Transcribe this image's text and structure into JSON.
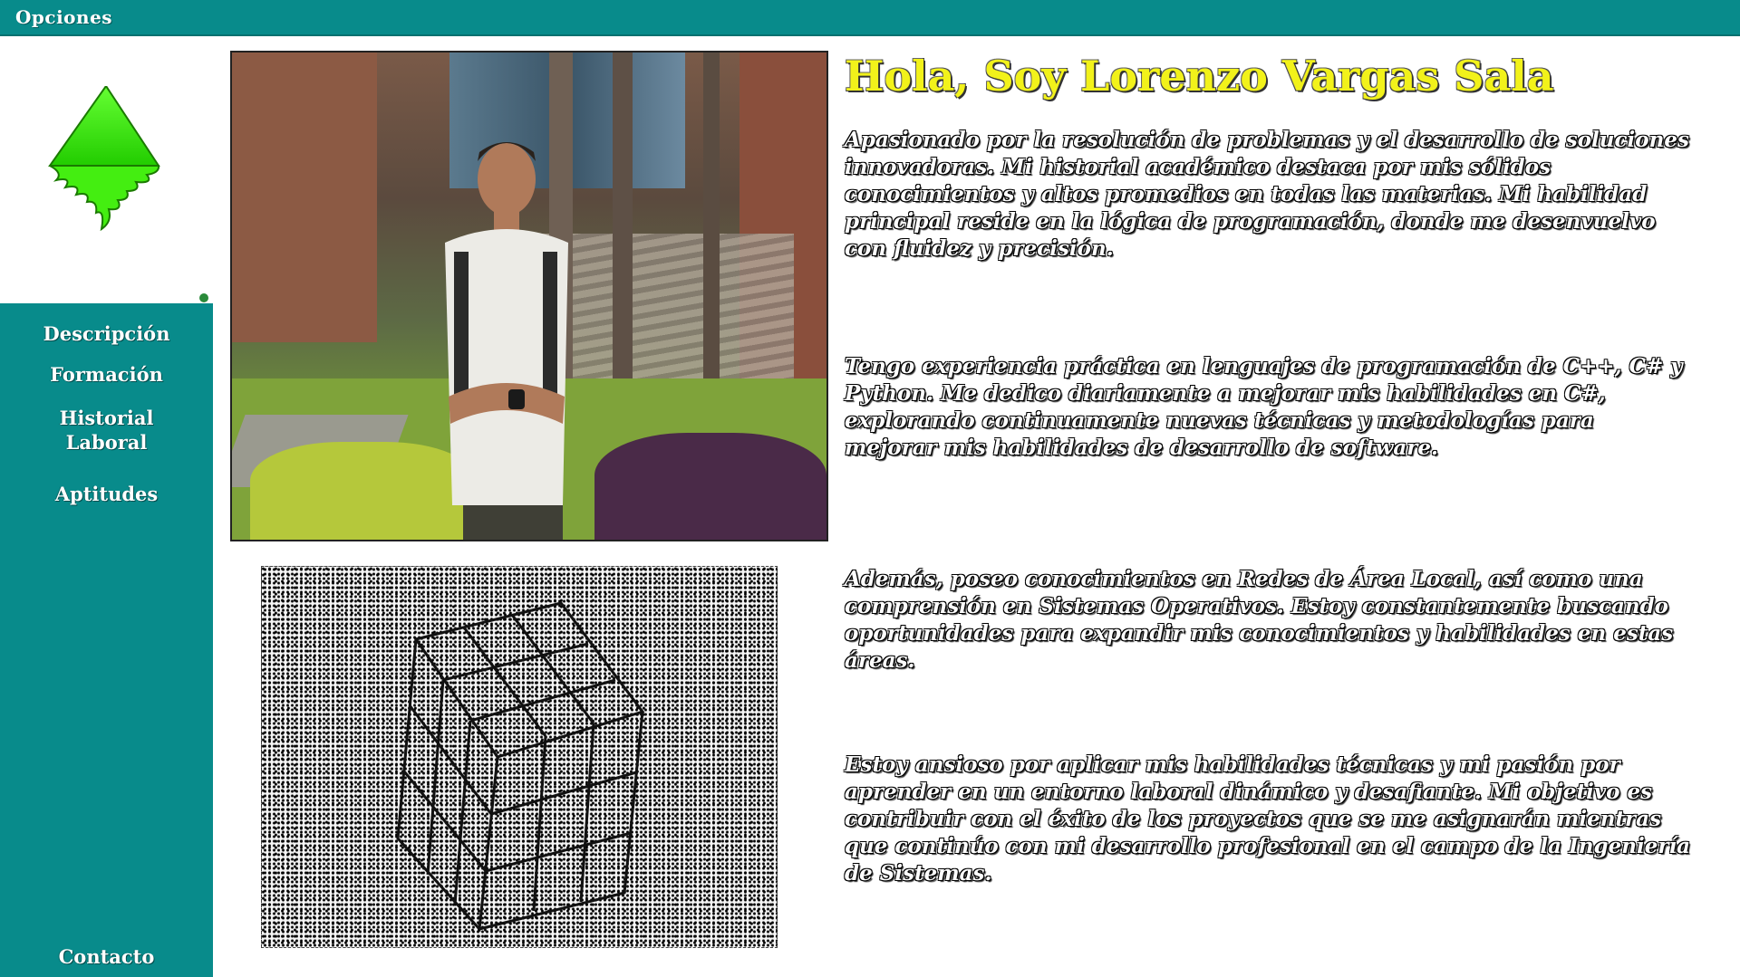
{
  "topbar": {
    "label": "Opciones"
  },
  "sidebar": {
    "items": [
      {
        "label": "Descripción"
      },
      {
        "label": "Formación"
      },
      {
        "label": "Historial Laboral"
      },
      {
        "label": "Aptitudes"
      }
    ],
    "contact_label": "Contacto"
  },
  "logo": {
    "icon": "green-drop-tree-icon",
    "color": "#33dd00"
  },
  "main": {
    "heading": "Hola, Soy Lorenzo Vargas Sala",
    "paragraphs": [
      "Apasionado por la resolución de problemas y el desarrollo de soluciones innovadoras. Mi historial académico destaca por mis sólidos conocimientos y altos promedios en todas las materias. Mi habilidad principal reside en la lógica de programación, donde me desenvuelvo con fluidez y precisión.",
      "Tengo experiencia práctica en lenguajes de programación de C++, C# y Python. Me dedico diariamente a mejorar mis habilidades en C#, explorando continuamente nuevas técnicas y metodologías para mejorar mis habilidades de desarrollo de software.",
      "Además, poseo conocimientos en Redes de Área Local, así como una comprensión en Sistemas Operativos. Estoy constantemente buscando oportunidades para expandir mis conocimientos y habilidades en estas áreas.",
      "Estoy ansioso por aplicar mis habilidades técnicas y mi pasión por aprender en un entorno laboral dinámico y desafiante. Mi objetivo es contribuir con el éxito de los proyectos que se me asignarán mientras que continúo con mi desarrollo profesional en el campo de la Ingeniería de Sistemas."
    ]
  },
  "colors": {
    "teal": "#088b8b",
    "heading_yellow": "#f2f21a"
  }
}
